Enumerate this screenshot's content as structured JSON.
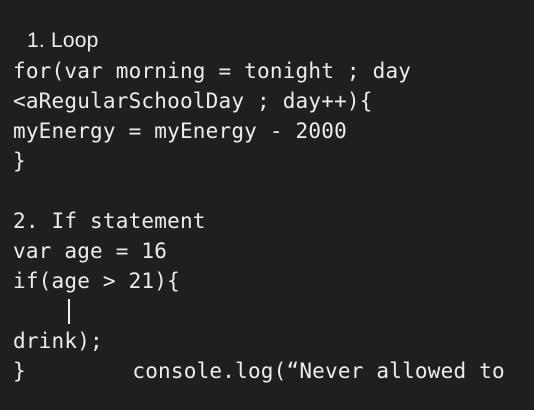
{
  "editor": {
    "heading_loop": "1. Loop",
    "loop_line_1": "for(var morning = tonight ; day",
    "loop_line_2": "<aRegularSchoolDay ; day++){",
    "loop_line_3": "myEnergy = myEnergy - 2000",
    "loop_line_4": "}",
    "heading_if": "2. If statement",
    "if_line_1": "var age = 16",
    "if_line_2": "if(age > 21){",
    "if_line_3": "console.log(“Never allowed to",
    "if_line_4": "drink);",
    "if_line_5": "}"
  }
}
